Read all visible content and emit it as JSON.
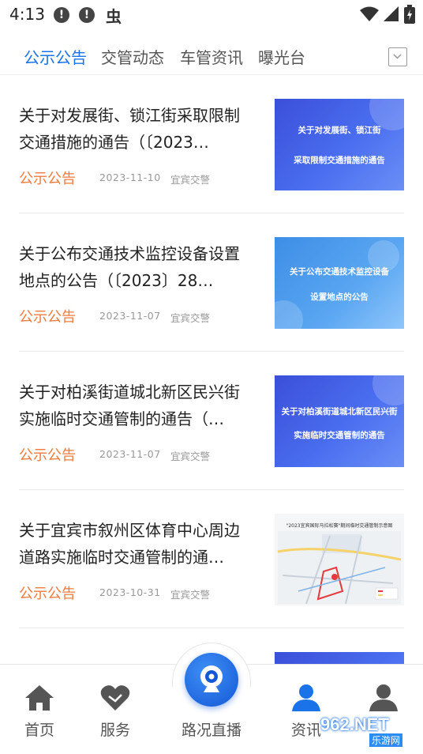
{
  "status_bar": {
    "time": "4:13",
    "alert_glyph": "!",
    "bug_glyph": "虫",
    "icons": [
      "alert-icon",
      "alert-icon",
      "bug-icon",
      "wifi-icon",
      "signal-icon",
      "battery-icon"
    ]
  },
  "tabs": {
    "items": [
      {
        "label": "公示公告",
        "active": true
      },
      {
        "label": "交管动态",
        "active": false
      },
      {
        "label": "车管资讯",
        "active": false
      },
      {
        "label": "曝光台",
        "active": false
      }
    ],
    "dropdown_icon": "chevron-down-icon"
  },
  "news": [
    {
      "title": "关于对发展街、锁江街采取限制交通措施的通告（〔2023…",
      "category": "公示公告",
      "date": "2023-11-10",
      "source": "宜宾交警",
      "thumb_lines": [
        "关于对发展街、锁江街",
        "采取限制交通措施的通告"
      ]
    },
    {
      "title": "关于公布交通技术监控设备设置地点的公告（〔2023〕28…",
      "category": "公示公告",
      "date": "2023-11-07",
      "source": "宜宾交警",
      "thumb_lines": [
        "关于公布交通技术监控设备",
        "设置地点的公告"
      ]
    },
    {
      "title": "关于对柏溪街道城北新区民兴街实施临时交通管制的通告（…",
      "category": "公示公告",
      "date": "2023-11-07",
      "source": "宜宾交警",
      "thumb_lines": [
        "关于对柏溪街道城北新区民兴街",
        "实施临时交通管制的通告"
      ]
    },
    {
      "title": "关于宜宾市叙州区体育中心周边道路实施临时交通管制的通…",
      "category": "公示公告",
      "date": "2023-10-31",
      "source": "宜宾交警",
      "thumb_caption": "\"2023宜宾国际马拉松赛\"期间临时交通管制示意图"
    }
  ],
  "bottom_nav": {
    "items": [
      {
        "label": "首页",
        "icon": "home-icon",
        "active": false
      },
      {
        "label": "服务",
        "icon": "service-heart-icon",
        "active": false
      },
      {
        "label": "路况直播",
        "icon": "webcam-icon",
        "active": false
      },
      {
        "label": "资讯",
        "icon": "user-info-icon",
        "active": true
      },
      {
        "label": "",
        "icon": "profile-icon",
        "active": false
      }
    ]
  },
  "watermark": {
    "text": "962.NET",
    "sub": "乐游网"
  },
  "colors": {
    "accent": "#1a73e8",
    "category": "#f07a3c",
    "meta": "#999999"
  }
}
